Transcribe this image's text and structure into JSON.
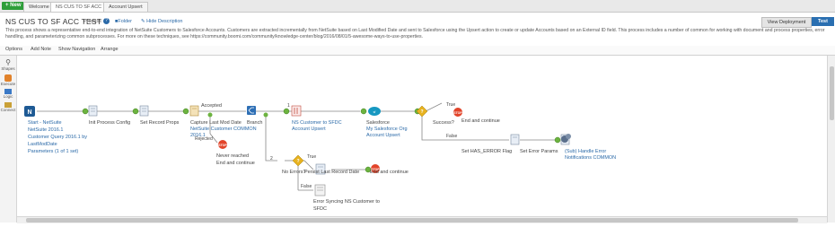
{
  "tabs": {
    "new_label": "+ New",
    "items": [
      {
        "label": "Welcome"
      },
      {
        "label": "NS CUS TO SF ACC TEST"
      },
      {
        "label": "Account Upsert"
      }
    ]
  },
  "header": {
    "title": "NS CUS TO SF ACC TEST",
    "type_label": "Process",
    "folder_label": "Folder",
    "hide_label": "Hide Description",
    "view_deployment": "View Deployment",
    "test": "Test",
    "description": "This process shows a representative end-to-end integration of NetSuite Customers to Salesforce Accounts. Customers are extracted incrementally from NetSuite based on Last Modified Date and sent to Salesforce using the Upsert action to create or update Accounts based on an External ID field. This process includes a number of common for working with document and process properties, error handling, and parameterizing common subprocesses. For more on these techniques, see https://community.boomi.com/community/knowledge-center/blog/2016/08/01/5-awesome-ways-to-use-properties."
  },
  "menu": [
    "Options",
    "Add Note",
    "Show Navigation",
    "Arrange"
  ],
  "tools": [
    "Shapes",
    "Execute",
    "Logic",
    "Connect"
  ],
  "flow": {
    "start_lines": [
      "Start - NetSuite",
      "NetSuite 2016.1",
      "Customer Query 2016.1 by",
      "LastModDate",
      "Parameters (1 of 1 set)"
    ],
    "init_label": "Init Process Config",
    "set_props_label": "Set Record Props",
    "capture_lines": [
      "Capture Last Mod Date",
      "NetSuite Customer COMMON",
      "2016.1"
    ],
    "accepted": "Accepted",
    "rejected": "Rejected",
    "branch_label": "Branch",
    "branch1": "1",
    "branch2": "2",
    "never_lines": [
      "Never reached",
      "End and continue"
    ],
    "map_lines": [
      "NS Customer to SFDC",
      "Account Upsert"
    ],
    "sf_lines": [
      "Salesforce",
      "My Salesforce Org",
      "Account Upsert"
    ],
    "success_label": "Success?",
    "true_label": "True",
    "false_label": "False",
    "end_continue": "End and continue",
    "set_has_error": "Set HAS_ERROR Flag",
    "set_error_params": "Set Error Params",
    "sub_lines": [
      "(Sub) Handle Error",
      "Notifications COMMON"
    ],
    "no_errors": "No Errors?",
    "persist_label": "Persist Last Record Date",
    "true2": "True",
    "false2": "False",
    "end2": "End and continue",
    "err_lines": [
      "Error Syncing NS Customer to",
      "SFDC"
    ]
  }
}
